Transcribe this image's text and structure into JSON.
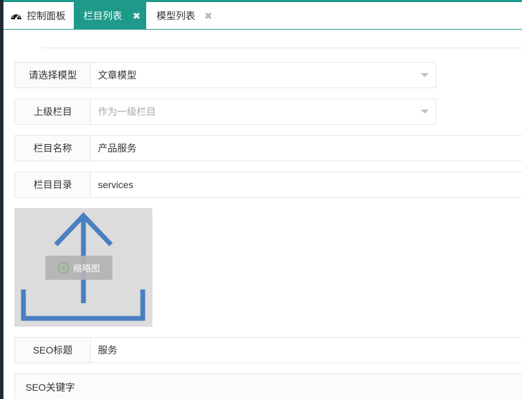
{
  "tabs": [
    {
      "label": "控制面板",
      "icon": "dashboard-icon",
      "active": false,
      "closable": false
    },
    {
      "label": "栏目列表",
      "active": true,
      "closable": true,
      "close_glyph": "✖"
    },
    {
      "label": "模型列表",
      "active": false,
      "closable": true,
      "close_glyph": "✖"
    }
  ],
  "form": {
    "model": {
      "label": "请选择模型",
      "value": "文章模型"
    },
    "parent": {
      "label": "上级栏目",
      "placeholder": "作为一级栏目"
    },
    "name": {
      "label": "栏目名称",
      "value": "产品服务"
    },
    "dir": {
      "label": "栏目目录",
      "value": "services"
    },
    "thumbnail": {
      "label": "缩略图",
      "plus": "+",
      "icon": "upload-icon"
    },
    "seo_title": {
      "label": "SEO标题",
      "value": "服务"
    },
    "seo_keywords": {
      "label": "SEO关键字"
    }
  },
  "colors": {
    "accent": "#1e9a8a",
    "upload_icon": "#4a7fc1",
    "plus_icon": "#62b25f"
  }
}
